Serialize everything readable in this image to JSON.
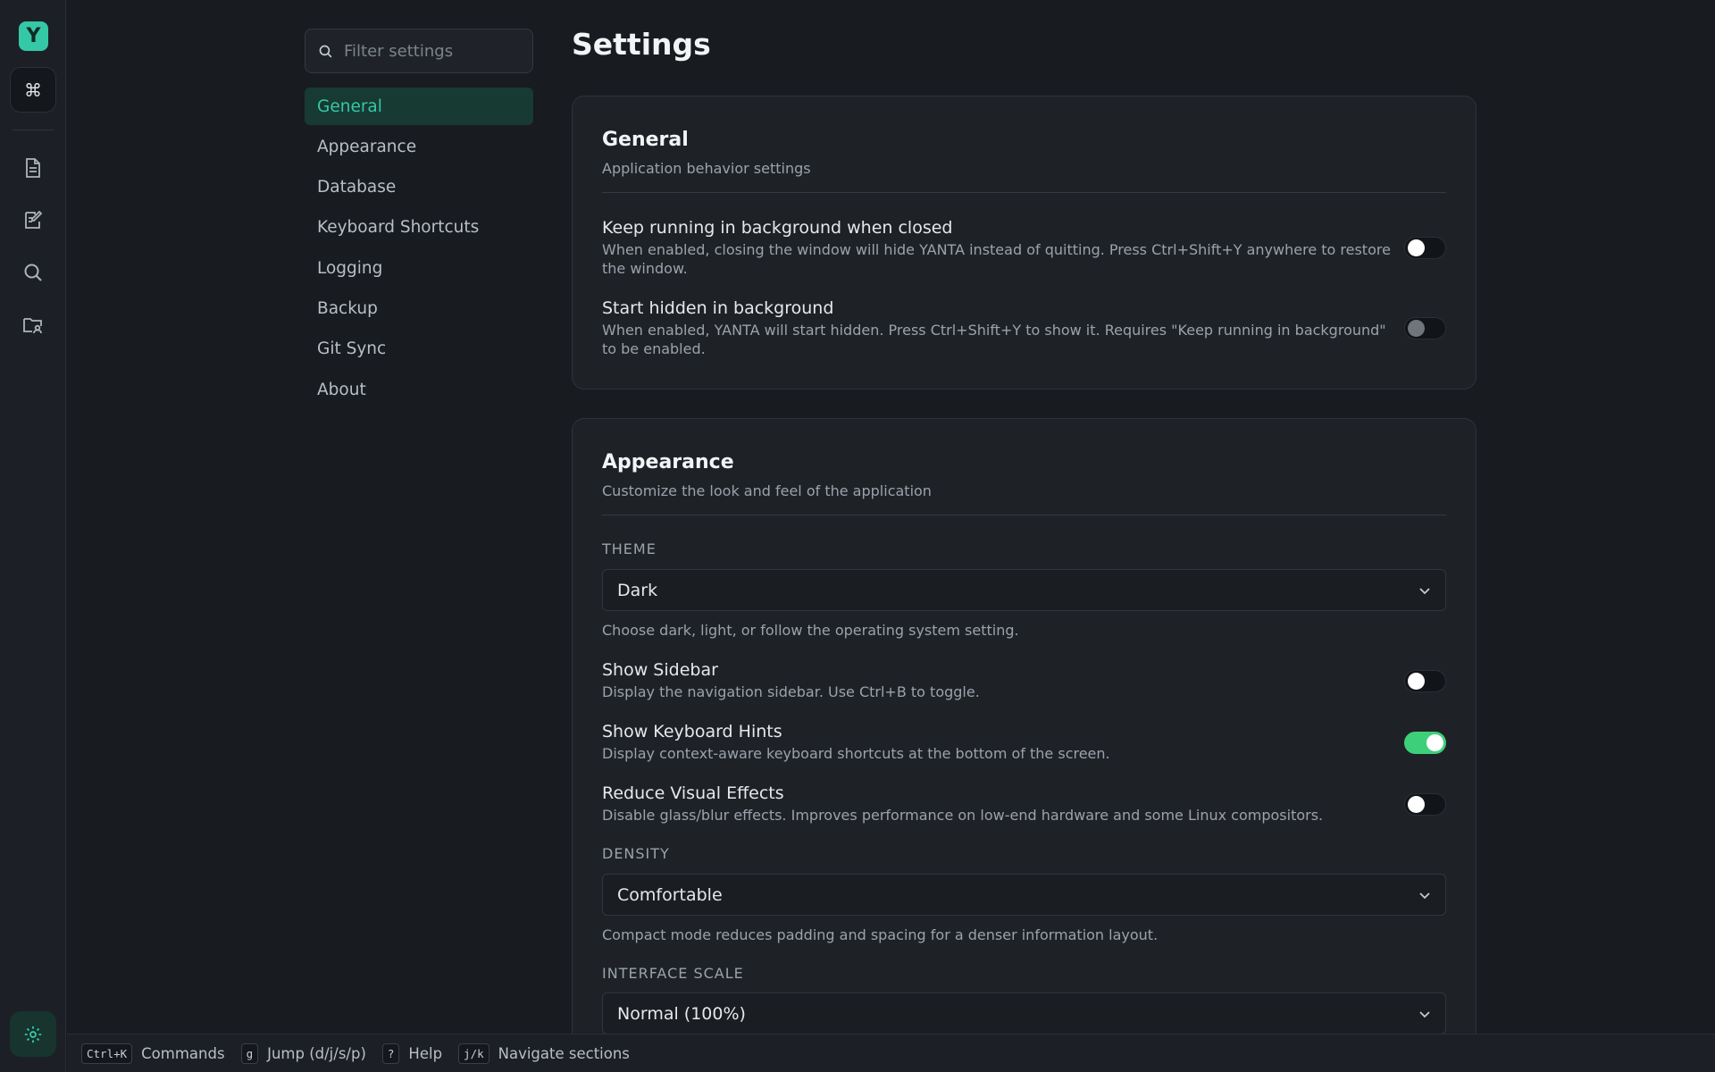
{
  "rail": {
    "logo": "Y",
    "cmd_glyph": "⌘",
    "icons": [
      "document-icon",
      "edit-note-icon",
      "search-icon",
      "folder-user-icon"
    ],
    "bottom_icon": "gear-icon"
  },
  "search": {
    "placeholder": "Filter settings"
  },
  "nav": {
    "items": [
      {
        "label": "General",
        "active": true
      },
      {
        "label": "Appearance",
        "active": false
      },
      {
        "label": "Database",
        "active": false
      },
      {
        "label": "Keyboard Shortcuts",
        "active": false
      },
      {
        "label": "Logging",
        "active": false
      },
      {
        "label": "Backup",
        "active": false
      },
      {
        "label": "Git Sync",
        "active": false
      },
      {
        "label": "About",
        "active": false
      }
    ]
  },
  "page": {
    "title": "Settings"
  },
  "general": {
    "title": "General",
    "subtitle": "Application behavior settings",
    "rows": [
      {
        "title": "Keep running in background when closed",
        "desc": "When enabled, closing the window will hide YANTA instead of quitting. Press Ctrl+Shift+Y anywhere to restore the window.",
        "enabled": false
      },
      {
        "title": "Start hidden in background",
        "desc": "When enabled, YANTA will start hidden. Press Ctrl+Shift+Y to show it. Requires \"Keep running in background\" to be enabled.",
        "enabled": false,
        "disabled": true
      }
    ]
  },
  "appearance": {
    "title": "Appearance",
    "subtitle": "Customize the look and feel of the application",
    "theme": {
      "label": "THEME",
      "value": "Dark",
      "help": "Choose dark, light, or follow the operating system setting."
    },
    "rows": [
      {
        "title": "Show Sidebar",
        "desc": "Display the navigation sidebar. Use Ctrl+B to toggle.",
        "enabled": false
      },
      {
        "title": "Show Keyboard Hints",
        "desc": "Display context-aware keyboard shortcuts at the bottom of the screen.",
        "enabled": true
      },
      {
        "title": "Reduce Visual Effects",
        "desc": "Disable glass/blur effects. Improves performance on low-end hardware and some Linux compositors.",
        "enabled": false
      }
    ],
    "density": {
      "label": "DENSITY",
      "value": "Comfortable",
      "help": "Compact mode reduces padding and spacing for a denser information layout."
    },
    "scale": {
      "label": "INTERFACE SCALE",
      "value": "Normal (100%)"
    }
  },
  "footer": {
    "hints": [
      {
        "key": "Ctrl+K",
        "label": "Commands"
      },
      {
        "key": "g",
        "label": "Jump (d/j/s/p)"
      },
      {
        "key": "?",
        "label": "Help"
      },
      {
        "key": "j/k",
        "label": "Navigate sections"
      }
    ]
  },
  "colors": {
    "accent": "#35c8a6",
    "toggle_on": "#3ecf7a",
    "background": "#181b20"
  }
}
